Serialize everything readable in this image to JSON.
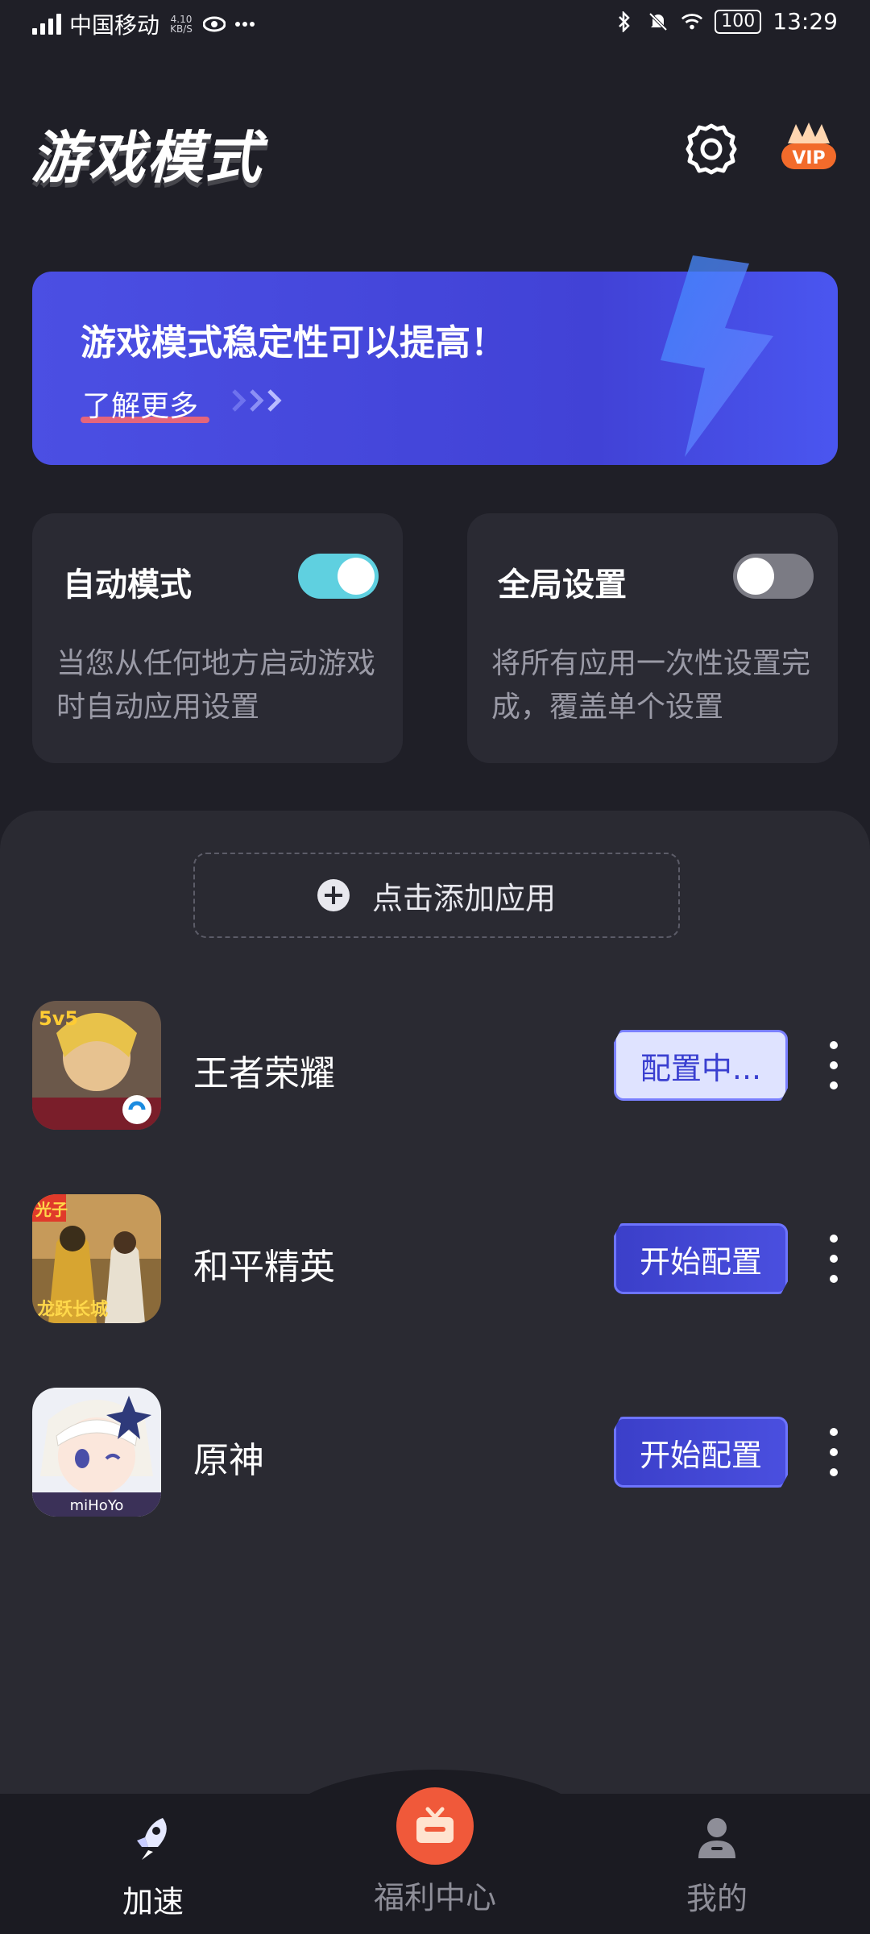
{
  "status_bar": {
    "carrier": "中国移动",
    "speed": "4.10\nKB/S",
    "speed_value": "4.10",
    "speed_unit": "KB/S",
    "battery": "100",
    "time": "13:29"
  },
  "header": {
    "title": "游戏模式"
  },
  "banner": {
    "title": "游戏模式稳定性可以提高！",
    "link": "了解更多"
  },
  "cards": {
    "auto": {
      "title": "自动模式",
      "desc": "当您从任何地方启动游戏时自动应用设置",
      "enabled": true
    },
    "global": {
      "title": "全局设置",
      "desc": "将所有应用一次性设置完成，覆盖单个设置",
      "enabled": false
    }
  },
  "add_app": {
    "label": "点击添加应用"
  },
  "apps": [
    {
      "name": "王者荣耀",
      "button": "配置中...",
      "state": "configuring"
    },
    {
      "name": "和平精英",
      "button": "开始配置",
      "state": "idle"
    },
    {
      "name": "原神",
      "button": "开始配置",
      "state": "idle"
    }
  ],
  "nav": {
    "items": [
      {
        "label": "加速",
        "icon": "rocket-icon",
        "active": true
      },
      {
        "label": "福利中心",
        "icon": "gift-icon",
        "active": false
      },
      {
        "label": "我的",
        "icon": "person-icon",
        "active": false
      }
    ]
  },
  "colors": {
    "background": "#1f1f27",
    "banner": "#4345d8",
    "toggle_on": "#5fd0e0",
    "accent_red": "#f0593a"
  }
}
